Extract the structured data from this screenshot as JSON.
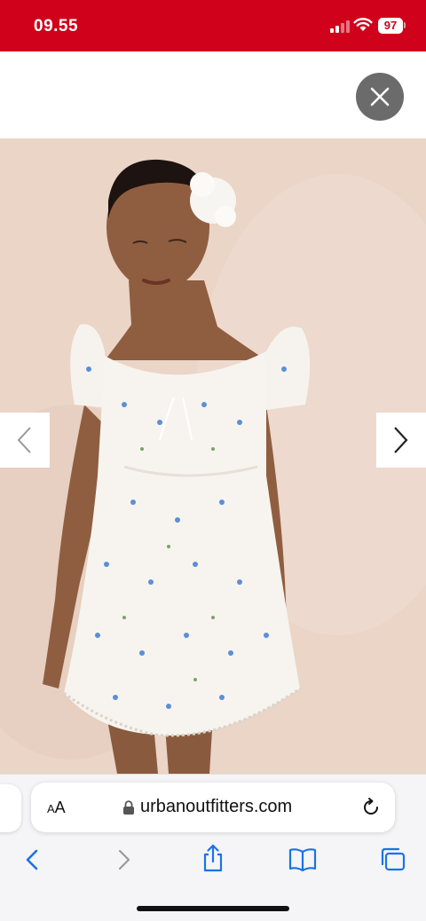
{
  "status_bar": {
    "time": "09.55",
    "battery": "97",
    "background_color": "#d0021b"
  },
  "close_button": {
    "icon": "close-icon"
  },
  "gallery": {
    "image_subject": "product-photo",
    "prev_icon": "chevron-left-icon",
    "next_icon": "chevron-right-icon"
  },
  "browser": {
    "text_size_label_small": "A",
    "text_size_label_large": "A",
    "url": "urbanoutfitters.com",
    "lock_icon": "lock-icon",
    "reload_icon": "reload-icon"
  },
  "toolbar": {
    "items": [
      "back-icon",
      "forward-icon",
      "share-icon",
      "bookmarks-icon",
      "tabs-icon"
    ]
  },
  "colors": {
    "accent_blue": "#1a73e8",
    "disabled_gray": "#9a9a9a"
  }
}
